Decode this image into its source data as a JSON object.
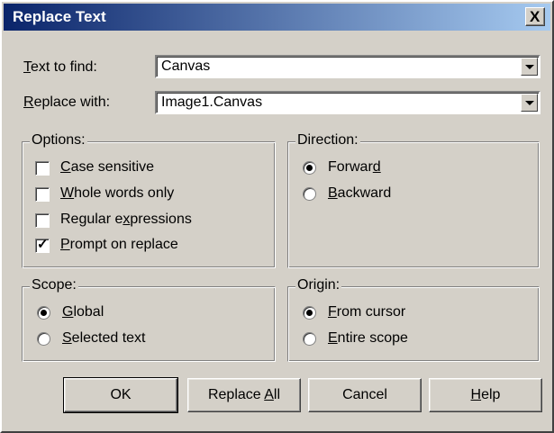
{
  "window": {
    "title": "Replace Text",
    "close_label": "X"
  },
  "find": {
    "label_pre": "",
    "label_key": "T",
    "label_post": "ext to find:",
    "value_hl": "C",
    "value_rest": "anvas"
  },
  "replace": {
    "label_pre": "",
    "label_key": "R",
    "label_post": "eplace with:",
    "value": "Image1.Canvas"
  },
  "options": {
    "title": "Options:",
    "items": [
      {
        "pre": "",
        "key": "C",
        "post": "ase sensitive",
        "checked": false
      },
      {
        "pre": "",
        "key": "W",
        "post": "hole words only",
        "checked": false
      },
      {
        "pre": "Regular e",
        "key": "x",
        "post": "pressions",
        "checked": false
      },
      {
        "pre": "",
        "key": "P",
        "post": "rompt on replace",
        "checked": true
      }
    ],
    "check_glyph": "✓"
  },
  "direction": {
    "title": "Direction:",
    "items": [
      {
        "pre": "Forwar",
        "key": "d",
        "post": "",
        "selected": true
      },
      {
        "pre": "",
        "key": "B",
        "post": "ackward",
        "selected": false
      }
    ]
  },
  "scope": {
    "title": "Scope:",
    "items": [
      {
        "pre": "",
        "key": "G",
        "post": "lobal",
        "selected": true
      },
      {
        "pre": "",
        "key": "S",
        "post": "elected text",
        "selected": false
      }
    ]
  },
  "origin": {
    "title": "Origin:",
    "items": [
      {
        "pre": "",
        "key": "F",
        "post": "rom cursor",
        "selected": true
      },
      {
        "pre": "",
        "key": "E",
        "post": "ntire scope",
        "selected": false
      }
    ]
  },
  "buttons": {
    "ok": "OK",
    "replace_all_pre": "Replace ",
    "replace_all_key": "A",
    "replace_all_post": "ll",
    "cancel": "Cancel",
    "help_key": "H",
    "help_post": "elp"
  }
}
